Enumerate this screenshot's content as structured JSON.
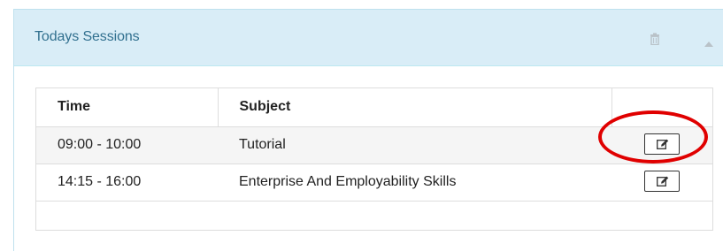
{
  "panel": {
    "title": "Todays Sessions",
    "icons": [
      "trash-icon",
      "collapse-up-icon"
    ]
  },
  "table": {
    "headers": {
      "time": "Time",
      "subject": "Subject",
      "action": ""
    },
    "rows": [
      {
        "time": "09:00 - 10:00",
        "subject": "Tutorial",
        "action_icon": "edit-icon"
      },
      {
        "time": "14:15 - 16:00",
        "subject": "Enterprise And Employability Skills",
        "action_icon": "edit-icon"
      }
    ]
  },
  "annotation": {
    "type": "highlight-circle",
    "color": "#e00000",
    "target": "first row edit button"
  },
  "colors": {
    "heading_bg": "#d9edf7",
    "heading_text": "#31708f",
    "highlight": "#e00000"
  }
}
